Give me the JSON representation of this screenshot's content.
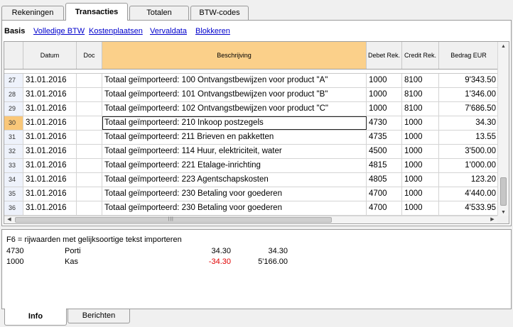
{
  "top_tabs": [
    "Rekeningen",
    "Transacties",
    "Totalen",
    "BTW-codes"
  ],
  "active_top_tab": "Transacties",
  "sub_tabs": [
    "Basis",
    "Volledige BTW",
    "Kostenplaatsen",
    "Vervaldata",
    "Blokkeren"
  ],
  "active_sub_tab": "Basis",
  "table": {
    "columns": [
      "",
      "Datum",
      "Doc",
      "Beschrijving",
      "Debet Rek.",
      "Credit Rek.",
      "Bedrag EUR"
    ],
    "rows": [
      {
        "num": "27",
        "date": "31.01.2016",
        "doc": "",
        "desc": "Totaal geïmporteerd: 100 Ontvangstbewijzen voor product \"A\"",
        "debit": "1000",
        "credit": "8100",
        "amount": "9'343.50"
      },
      {
        "num": "28",
        "date": "31.01.2016",
        "doc": "",
        "desc": "Totaal geïmporteerd: 101 Ontvangstbewijzen voor product \"B\"",
        "debit": "1000",
        "credit": "8100",
        "amount": "1'346.00"
      },
      {
        "num": "29",
        "date": "31.01.2016",
        "doc": "",
        "desc": "Totaal geïmporteerd: 102 Ontvangstbewijzen voor product \"C\"",
        "debit": "1000",
        "credit": "8100",
        "amount": "7'686.50"
      },
      {
        "num": "30",
        "date": "31.01.2016",
        "doc": "",
        "desc": "Totaal geïmporteerd: 210 Inkoop postzegels",
        "debit": "4730",
        "credit": "1000",
        "amount": "34.30"
      },
      {
        "num": "31",
        "date": "31.01.2016",
        "doc": "",
        "desc": "Totaal geïmporteerd: 211 Brieven en pakketten",
        "debit": "4735",
        "credit": "1000",
        "amount": "13.55"
      },
      {
        "num": "32",
        "date": "31.01.2016",
        "doc": "",
        "desc": "Totaal geïmporteerd: 114 Huur, elektriciteit, water",
        "debit": "4500",
        "credit": "1000",
        "amount": "3'500.00"
      },
      {
        "num": "33",
        "date": "31.01.2016",
        "doc": "",
        "desc": "Totaal geïmporteerd: 221 Etalage-inrichting",
        "debit": "4815",
        "credit": "1000",
        "amount": "1'000.00"
      },
      {
        "num": "34",
        "date": "31.01.2016",
        "doc": "",
        "desc": "Totaal geïmporteerd: 223 Agentschapskosten",
        "debit": "4805",
        "credit": "1000",
        "amount": "123.20"
      },
      {
        "num": "35",
        "date": "31.01.2016",
        "doc": "",
        "desc": "Totaal geïmporteerd: 230 Betaling voor goederen",
        "debit": "4700",
        "credit": "1000",
        "amount": "4'440.00"
      },
      {
        "num": "36",
        "date": "31.01.2016",
        "doc": "",
        "desc": "Totaal geïmporteerd: 230 Betaling voor goederen",
        "debit": "4700",
        "credit": "1000",
        "amount": "4'533.95"
      }
    ],
    "selected_row": "30"
  },
  "info": {
    "hint": "F6 = rijwaarden met gelijksoortige tekst importeren",
    "lines": [
      {
        "account": "4730",
        "name": "Porti",
        "amount": "34.30",
        "balance": "34.30"
      },
      {
        "account": "1000",
        "name": "Kas",
        "amount": "-34.30",
        "balance": "5'166.00"
      }
    ]
  },
  "bottom_tabs": [
    "Info",
    "Berichten"
  ],
  "active_bottom_tab": "Info",
  "colors": {
    "selection": "#f9c779",
    "negative": "#e00000",
    "link": "#0000cc"
  }
}
